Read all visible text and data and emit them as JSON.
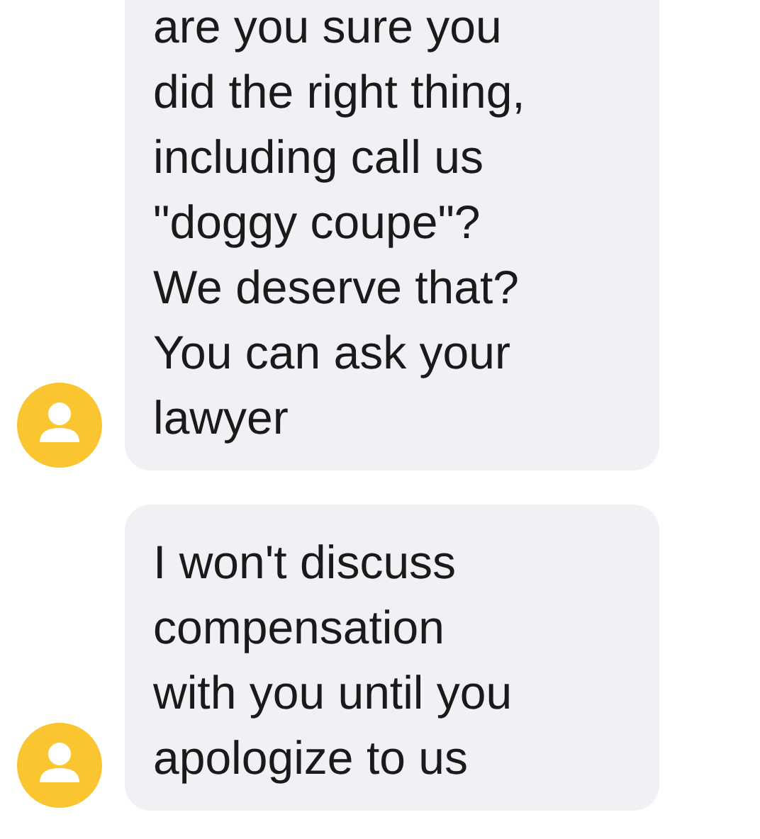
{
  "messages": [
    {
      "lines": [
        "are you sure you",
        "did the right thing,",
        "including call us",
        "\"doggy coupe\"?",
        "We deserve that?",
        "You can ask your",
        "lawyer"
      ]
    },
    {
      "lines": [
        "I won't discuss",
        "compensation",
        "with you until you",
        "apologize to us"
      ]
    }
  ]
}
